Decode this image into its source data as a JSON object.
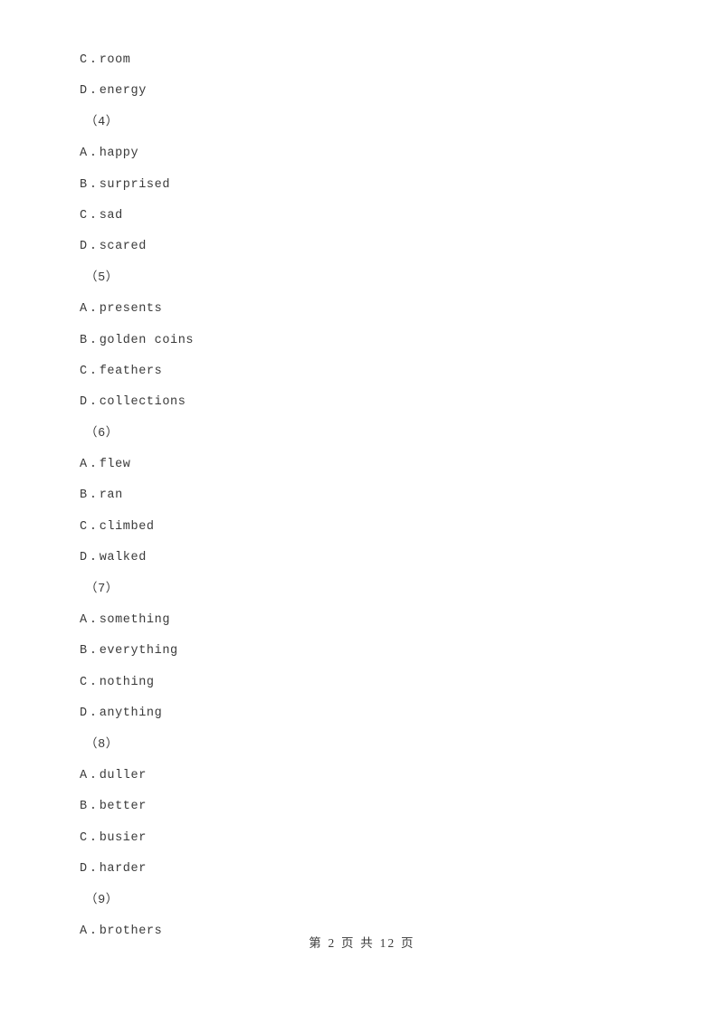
{
  "document": {
    "background_color": "#ffffff",
    "text_color": "#3a3a3a"
  },
  "lines": [
    {
      "type": "option",
      "letter": "C",
      "sep": ".",
      "text": "room"
    },
    {
      "type": "option",
      "letter": "D",
      "sep": ".",
      "text": "energy"
    },
    {
      "type": "qnum",
      "text": "（4）"
    },
    {
      "type": "option",
      "letter": "A",
      "sep": ".",
      "text": "happy"
    },
    {
      "type": "option",
      "letter": "B",
      "sep": ".",
      "text": "surprised"
    },
    {
      "type": "option",
      "letter": "C",
      "sep": ".",
      "text": "sad"
    },
    {
      "type": "option",
      "letter": "D",
      "sep": ".",
      "text": "scared"
    },
    {
      "type": "qnum",
      "text": "（5）"
    },
    {
      "type": "option",
      "letter": "A",
      "sep": ".",
      "text": "presents"
    },
    {
      "type": "option",
      "letter": "B",
      "sep": ".",
      "text": "golden coins"
    },
    {
      "type": "option",
      "letter": "C",
      "sep": ".",
      "text": "feathers"
    },
    {
      "type": "option",
      "letter": "D",
      "sep": ".",
      "text": "collections"
    },
    {
      "type": "qnum",
      "text": "（6）"
    },
    {
      "type": "option",
      "letter": "A",
      "sep": ".",
      "text": "flew"
    },
    {
      "type": "option",
      "letter": "B",
      "sep": ".",
      "text": "ran"
    },
    {
      "type": "option",
      "letter": "C",
      "sep": ".",
      "text": "climbed"
    },
    {
      "type": "option",
      "letter": "D",
      "sep": ".",
      "text": "walked"
    },
    {
      "type": "qnum",
      "text": "（7）"
    },
    {
      "type": "option",
      "letter": "A",
      "sep": ".",
      "text": "something"
    },
    {
      "type": "option",
      "letter": "B",
      "sep": ".",
      "text": "everything"
    },
    {
      "type": "option",
      "letter": "C",
      "sep": ".",
      "text": "nothing"
    },
    {
      "type": "option",
      "letter": "D",
      "sep": ".",
      "text": "anything"
    },
    {
      "type": "qnum",
      "text": "（8）"
    },
    {
      "type": "option",
      "letter": "A",
      "sep": ".",
      "text": "duller"
    },
    {
      "type": "option",
      "letter": "B",
      "sep": ".",
      "text": "better"
    },
    {
      "type": "option",
      "letter": "C",
      "sep": ".",
      "text": "busier"
    },
    {
      "type": "option",
      "letter": "D",
      "sep": ".",
      "text": "harder"
    },
    {
      "type": "qnum",
      "text": "（9）"
    },
    {
      "type": "option",
      "letter": "A",
      "sep": ".",
      "text": "brothers"
    }
  ],
  "footer": {
    "text": "第 2 页 共 12 页",
    "current_page": "2",
    "total_pages": "12"
  }
}
